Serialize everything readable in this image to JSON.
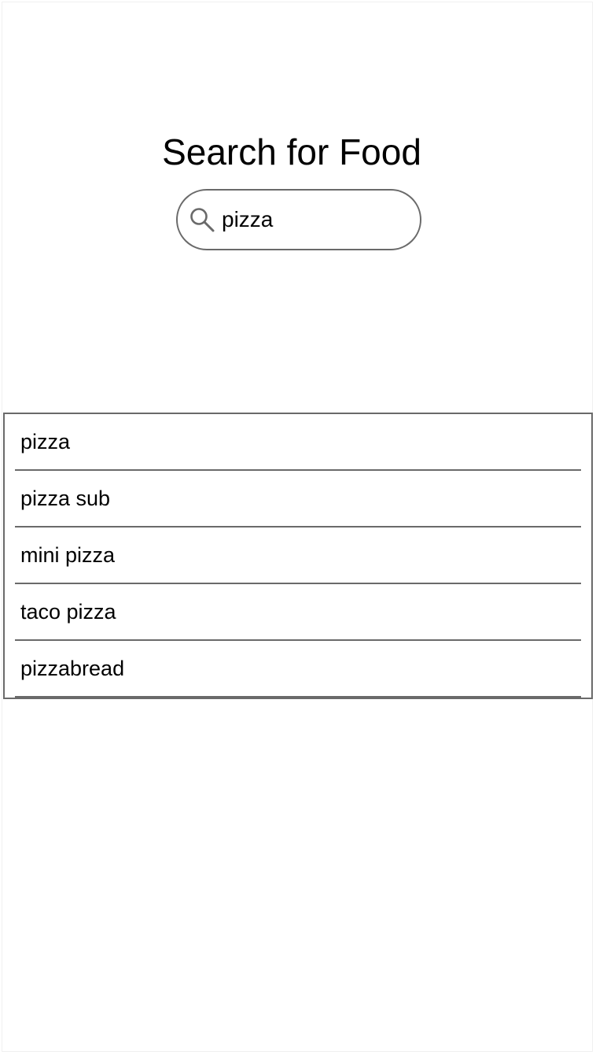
{
  "page": {
    "title": "Search for Food"
  },
  "search": {
    "value": "pizza",
    "icon": "search-icon"
  },
  "results": {
    "items": [
      {
        "label": "pizza"
      },
      {
        "label": "pizza sub"
      },
      {
        "label": "mini pizza"
      },
      {
        "label": "taco pizza"
      },
      {
        "label": "pizzabread"
      }
    ]
  },
  "colors": {
    "border": "#6a6a6a",
    "text": "#000000",
    "background": "#ffffff"
  }
}
